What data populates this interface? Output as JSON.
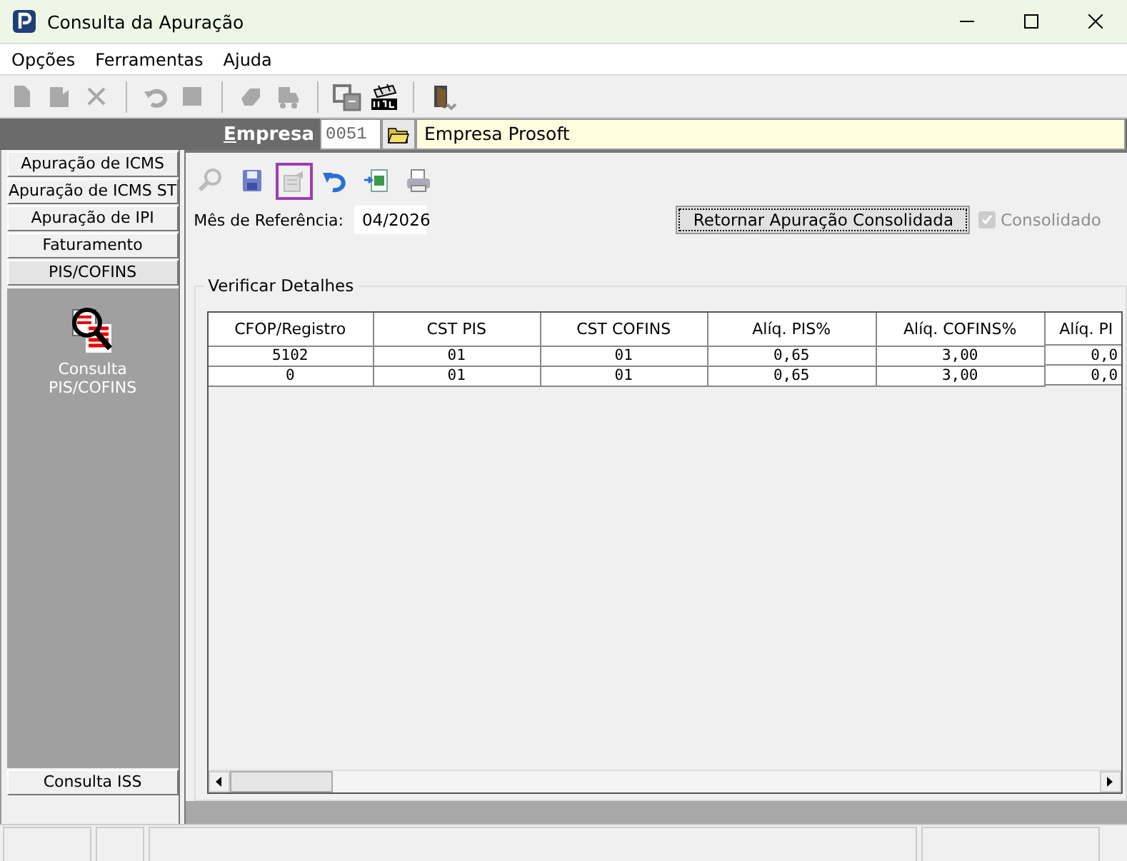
{
  "window": {
    "title": "Consulta da Apuração"
  },
  "menu": [
    "Opções",
    "Ferramentas",
    "Ajuda"
  ],
  "toolbar": [
    {
      "kind": "new",
      "disabled": true
    },
    {
      "kind": "edit",
      "disabled": true
    },
    {
      "kind": "delete",
      "disabled": true
    },
    {
      "kind": "sep"
    },
    {
      "kind": "undo",
      "disabled": true
    },
    {
      "kind": "stop",
      "disabled": true
    },
    {
      "kind": "sep"
    },
    {
      "kind": "eraser",
      "disabled": true
    },
    {
      "kind": "truck",
      "disabled": true
    },
    {
      "kind": "sep"
    },
    {
      "kind": "copy",
      "disabled": false
    },
    {
      "kind": "stamp",
      "disabled": false
    },
    {
      "kind": "sep"
    },
    {
      "kind": "exit",
      "disabled": false
    }
  ],
  "company": {
    "label": "Empresa",
    "code": "0051",
    "name": "Empresa Prosoft"
  },
  "sidebar": {
    "tabs": [
      {
        "label": "Apuração de ICMS",
        "selected": false
      },
      {
        "label": "Apuração de ICMS ST",
        "selected": false
      },
      {
        "label": "Apuração de IPI",
        "selected": false
      },
      {
        "label": "Faturamento",
        "selected": false
      },
      {
        "label": "PIS/COFINS",
        "selected": true
      }
    ],
    "items": [
      {
        "label": "Consulta PIS/COFINS"
      }
    ],
    "bottom_tabs": [
      {
        "label": "Consulta ISS",
        "selected": false
      }
    ]
  },
  "actions": [
    {
      "kind": "search",
      "focused": false
    },
    {
      "kind": "save",
      "focused": false
    },
    {
      "kind": "export",
      "focused": true
    },
    {
      "kind": "undo",
      "focused": false
    },
    {
      "kind": "excel",
      "focused": false
    },
    {
      "kind": "print",
      "focused": false
    }
  ],
  "reference": {
    "label": "Mês de Referência:",
    "value": "04/2026"
  },
  "return_button": "Retornar Apuração Consolidada",
  "consolidated": {
    "label": "Consolidado",
    "checked": true,
    "disabled": true
  },
  "details": {
    "title": "Verificar Detalhes",
    "table": {
      "columns": [
        "CFOP/Registro",
        "CST PIS",
        "CST COFINS",
        "Alíq. PIS%",
        "Alíq. COFINS%",
        "Alíq. PI"
      ],
      "rows": [
        [
          "5102",
          "01",
          "01",
          "0,65",
          "3,00",
          "0,0"
        ],
        [
          "0",
          "01",
          "01",
          "0,65",
          "3,00",
          "0,0"
        ]
      ]
    }
  }
}
